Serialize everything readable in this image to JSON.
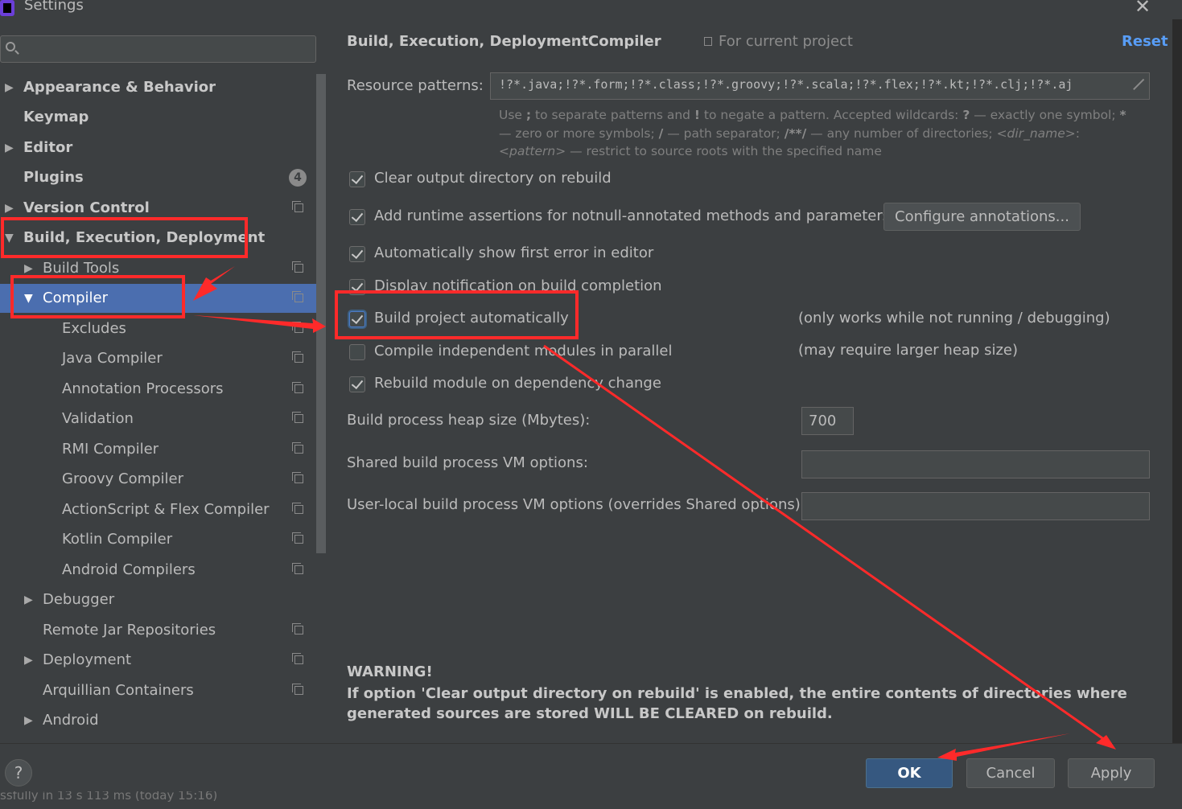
{
  "window": {
    "title": "Settings"
  },
  "search": {
    "placeholder": ""
  },
  "sidebar": {
    "items": [
      {
        "label": "Appearance & Behavior",
        "arrow": "▶"
      },
      {
        "label": "Keymap"
      },
      {
        "label": "Editor",
        "arrow": "▶"
      },
      {
        "label": "Plugins",
        "badge": "4"
      },
      {
        "label": "Version Control",
        "arrow": "▶"
      },
      {
        "label": "Build, Execution, Deployment",
        "arrow": "▼"
      },
      {
        "label": "Build Tools",
        "arrow": "▶"
      },
      {
        "label": "Compiler",
        "arrow": "▼"
      },
      {
        "label": "Excludes"
      },
      {
        "label": "Java Compiler"
      },
      {
        "label": "Annotation Processors"
      },
      {
        "label": "Validation"
      },
      {
        "label": "RMI Compiler"
      },
      {
        "label": "Groovy Compiler"
      },
      {
        "label": "ActionScript & Flex Compiler"
      },
      {
        "label": "Kotlin Compiler"
      },
      {
        "label": "Android Compilers"
      },
      {
        "label": "Debugger",
        "arrow": "▶"
      },
      {
        "label": "Remote Jar Repositories"
      },
      {
        "label": "Deployment",
        "arrow": "▶"
      },
      {
        "label": "Arquillian Containers"
      },
      {
        "label": "Android",
        "arrow": "▶"
      }
    ]
  },
  "header": {
    "breadcrumb": "Build, Execution, Deployment",
    "separator": "›",
    "current": "Compiler",
    "scope": "For current project",
    "reset": "Reset"
  },
  "resource_patterns": {
    "label": "Resource patterns:",
    "value": "!?*.java;!?*.form;!?*.class;!?*.groovy;!?*.scala;!?*.flex;!?*.kt;!?*.clj;!?*.aj",
    "help": {
      "t1": "Use ",
      "semi": ";",
      "t2": " to separate patterns and ",
      "bang": "!",
      "t3": " to negate a pattern. Accepted wildcards: ",
      "q": "?",
      "t4": " — exactly one symbol; ",
      "star": "*",
      "t5": " — zero or more symbols; ",
      "slash": "/",
      "t6": " — path separator; ",
      "globdir": "/**/",
      "t7": " — any number of directories; ",
      "dirname": "<dir_name>",
      "colon": ":",
      "pattern": "<pattern>",
      "t8": " — restrict to source roots with the specified name"
    }
  },
  "options": [
    {
      "label": "Clear output directory on rebuild",
      "checked": true
    },
    {
      "label": "Add runtime assertions for notnull-annotated methods and parameters",
      "checked": true
    },
    {
      "label": "Automatically show first error in editor",
      "checked": true
    },
    {
      "label": "Display notification on build completion",
      "checked": true
    },
    {
      "label": "Build project automatically",
      "checked": true,
      "note": "(only works while not running / debugging)"
    },
    {
      "label": "Compile independent modules in parallel",
      "checked": false,
      "note": "(may require larger heap size)"
    },
    {
      "label": "Rebuild module on dependency change",
      "checked": true
    }
  ],
  "configure_button": "Configure annotations...",
  "heap": {
    "label": "Build process heap size (Mbytes):",
    "value": "700"
  },
  "shared_vm": {
    "label": "Shared build process VM options:",
    "value": ""
  },
  "user_vm": {
    "label": "User-local build process VM options (overrides Shared options):",
    "value": ""
  },
  "warning": {
    "title": "WARNING!",
    "text": "If option 'Clear output directory on rebuild' is enabled, the entire contents of directories where generated sources are stored WILL BE CLEARED on rebuild."
  },
  "footer": {
    "help": "?",
    "ok": "OK",
    "cancel": "Cancel",
    "apply": "Apply"
  },
  "status_bar": {
    "text": "ssfully in 13 s 113 ms (today 15:16)"
  },
  "colors": {
    "background": "#3c3f41",
    "selection": "#4b6eaf",
    "link": "#589df6",
    "annotation": "#ff2a2a"
  }
}
